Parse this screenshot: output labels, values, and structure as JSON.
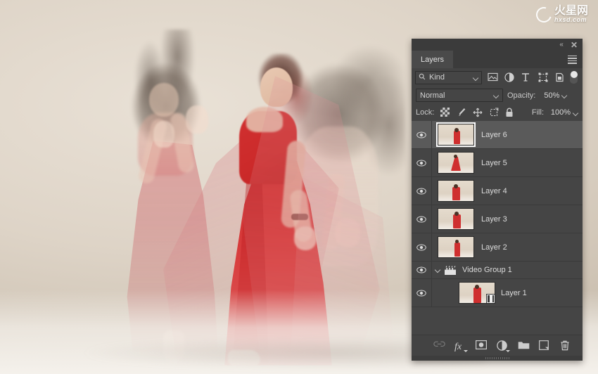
{
  "watermark": {
    "cn_text": "火星网",
    "domain": "hxsd.com",
    "mark": "swoosh-circle-icon"
  },
  "canvas": {
    "description": "Multiple-exposure photo of dancers in red chiffon dresses on a cream studio backdrop",
    "background_color": "#ded4c7",
    "dress_color": "#d23232"
  },
  "panel": {
    "titlebar": {
      "collapse_label": "«",
      "close_label": "✕"
    },
    "tab_label": "Layers",
    "menu_icon": "hamburger-menu-icon",
    "filter": {
      "search_icon": "search-icon",
      "kind_label": "Kind",
      "chevron": "chevron-down-icon",
      "icons": [
        "pixel-layer-filter-icon",
        "adjustment-layer-filter-icon",
        "type-layer-filter-icon",
        "shape-layer-filter-icon",
        "smart-object-filter-icon"
      ],
      "toggle": "filter-enable-toggle"
    },
    "blend": {
      "mode": "Normal",
      "opacity_label": "Opacity:",
      "opacity_value": "50%"
    },
    "lock": {
      "label": "Lock:",
      "icons": [
        "lock-transparent-pixels-icon",
        "lock-image-pixels-icon",
        "lock-position-icon",
        "lock-artboard-nesting-icon",
        "lock-all-icon"
      ],
      "fill_label": "Fill:",
      "fill_value": "100%"
    },
    "layers": [
      {
        "name": "Layer 6",
        "type": "pixel",
        "selected": true,
        "visible": true,
        "indent": false
      },
      {
        "name": "Layer 5",
        "type": "pixel",
        "selected": false,
        "visible": true,
        "indent": false
      },
      {
        "name": "Layer 4",
        "type": "pixel",
        "selected": false,
        "visible": true,
        "indent": false
      },
      {
        "name": "Layer 3",
        "type": "pixel",
        "selected": false,
        "visible": true,
        "indent": false
      },
      {
        "name": "Layer 2",
        "type": "pixel",
        "selected": false,
        "visible": true,
        "indent": false
      },
      {
        "name": "Video Group 1",
        "type": "group",
        "selected": false,
        "visible": true,
        "indent": false
      },
      {
        "name": "Layer 1",
        "type": "video",
        "selected": false,
        "visible": true,
        "indent": true
      }
    ],
    "footer_icons": [
      "link-layers-icon",
      "layer-style-fx-icon",
      "add-layer-mask-icon",
      "new-fill-adjustment-layer-icon",
      "new-group-icon",
      "new-layer-icon",
      "delete-layer-icon"
    ]
  }
}
